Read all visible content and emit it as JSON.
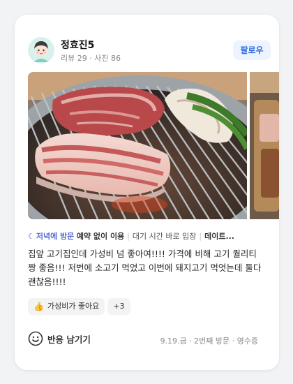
{
  "user": {
    "name": "정효진5",
    "stats": "리뷰 29 · 사진 86",
    "follow_label": "팔로우"
  },
  "tags": {
    "icon": "moon-icon",
    "items": [
      "저녁에 방문",
      "예약 없이 이용",
      "대기 시간 바로 입장",
      "데이트..."
    ]
  },
  "review": {
    "text": "집앞 고기집인데 가성비 넘 좋아여!!!! 가격에 비해 고기 퀄리티 짱 좋음!!! 저번에 소고기 먹었고 이번에 돼지고기 먹엇는데 둘다 괜찮음!!!!"
  },
  "chips": {
    "first": {
      "icon": "thumbs-up-icon",
      "label": "가성비가 좋아요"
    },
    "more": "+3"
  },
  "footer": {
    "react_label": "반응 남기기",
    "visit_info": "9.19.금 · 2번째 방문 · 영수증"
  },
  "colors": {
    "accent_blue": "#2d6cdf",
    "tag_purple": "#5b6fd6"
  }
}
